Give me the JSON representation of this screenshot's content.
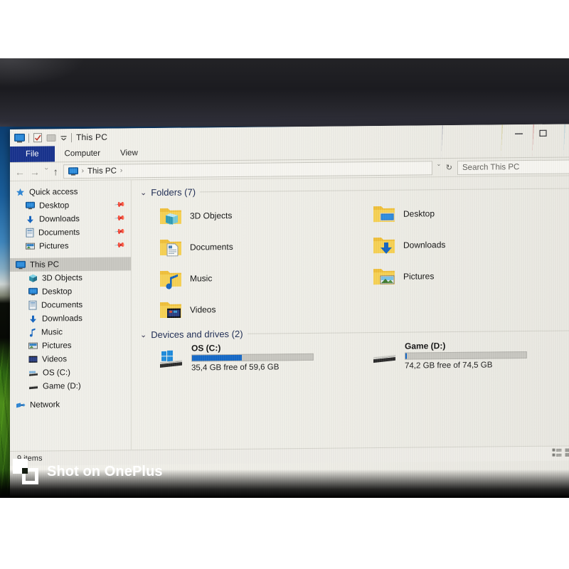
{
  "window": {
    "title": "This PC",
    "quick_access_toolbar": [
      {
        "name": "this-pc-icon",
        "label": "This PC"
      },
      {
        "name": "properties-icon",
        "label": "Properties"
      },
      {
        "name": "new-folder-icon",
        "label": "New folder"
      },
      {
        "name": "customize-chevron-icon",
        "label": "Customize Quick Access Toolbar"
      }
    ],
    "controls": {
      "minimize": "—",
      "maximize": "☐",
      "close": "✕"
    }
  },
  "ribbon": {
    "tabs": [
      {
        "label": "File",
        "active": true
      },
      {
        "label": "Computer",
        "active": false
      },
      {
        "label": "View",
        "active": false
      }
    ]
  },
  "addressbar": {
    "back": "←",
    "forward": "→",
    "recent": "ˇ",
    "up": "↑",
    "breadcrumb": [
      "This PC"
    ],
    "breadcrumb_separator": "›",
    "dropdown": "ˇ",
    "refresh": "↻",
    "search_placeholder": "Search This PC"
  },
  "sidebar": {
    "groups": [
      {
        "name": "quick-access",
        "label": "Quick access",
        "icon": "star-icon",
        "items": [
          {
            "label": "Desktop",
            "icon": "monitor-icon",
            "pinned": true
          },
          {
            "label": "Downloads",
            "icon": "download-arrow-icon",
            "pinned": true
          },
          {
            "label": "Documents",
            "icon": "document-icon",
            "pinned": true
          },
          {
            "label": "Pictures",
            "icon": "picture-icon",
            "pinned": true
          }
        ]
      },
      {
        "name": "this-pc",
        "label": "This PC",
        "icon": "monitor-icon",
        "selected": true,
        "items": [
          {
            "label": "3D Objects",
            "icon": "cube-icon"
          },
          {
            "label": "Desktop",
            "icon": "monitor-icon"
          },
          {
            "label": "Documents",
            "icon": "document-icon"
          },
          {
            "label": "Downloads",
            "icon": "download-arrow-icon"
          },
          {
            "label": "Music",
            "icon": "music-note-icon"
          },
          {
            "label": "Pictures",
            "icon": "picture-icon"
          },
          {
            "label": "Videos",
            "icon": "video-icon"
          },
          {
            "label": "OS (C:)",
            "icon": "drive-icon"
          },
          {
            "label": "Game (D:)",
            "icon": "drive-icon"
          }
        ]
      },
      {
        "name": "network",
        "label": "Network",
        "icon": "network-icon",
        "items": []
      }
    ]
  },
  "main": {
    "folders_group": {
      "label": "Folders (7)",
      "chevron": "⌄",
      "items": [
        {
          "label": "3D Objects",
          "icon": "folder-3d-objects-icon"
        },
        {
          "label": "Desktop",
          "icon": "folder-desktop-icon"
        },
        {
          "label": "Documents",
          "icon": "folder-documents-icon"
        },
        {
          "label": "Downloads",
          "icon": "folder-downloads-icon"
        },
        {
          "label": "Music",
          "icon": "folder-music-icon"
        },
        {
          "label": "Pictures",
          "icon": "folder-pictures-icon"
        },
        {
          "label": "Videos",
          "icon": "folder-videos-icon"
        }
      ]
    },
    "devices_group": {
      "label": "Devices and drives (2)",
      "chevron": "⌄",
      "items": [
        {
          "name": "OS (C:)",
          "icon": "windows-drive-icon",
          "free_text": "35,4 GB free of 59,6 GB",
          "free_gb": 35.4,
          "total_gb": 59.6,
          "used_percent": 41,
          "bar_color": "#1569c7"
        },
        {
          "name": "Game (D:)",
          "icon": "drive-icon",
          "free_text": "74,2 GB free of 74,5 GB",
          "free_gb": 74.2,
          "total_gb": 74.5,
          "used_percent": 1,
          "bar_color": "#1569c7"
        }
      ]
    }
  },
  "statusbar": {
    "item_count": "9 items",
    "view_buttons": [
      {
        "name": "details-view-button",
        "label": "Details view"
      },
      {
        "name": "large-icons-view-button",
        "label": "Large icons view"
      }
    ]
  },
  "watermark": {
    "text": "Shot on OnePlus"
  }
}
